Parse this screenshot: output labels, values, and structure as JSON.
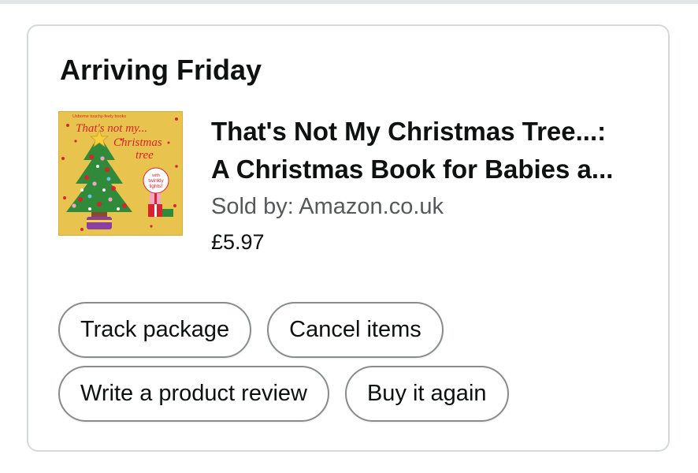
{
  "order": {
    "heading": "Arriving Friday",
    "item": {
      "title_line1": "That's Not My Christmas Tree...:",
      "title_line2": "A Christmas Book for Babies a...",
      "seller_label": "Sold by:",
      "seller_name": "Amazon.co.uk",
      "price": "£5.97",
      "cover": {
        "series_text": "Usborne touchy-feely books",
        "title_text_1": "That's not my...",
        "title_text_2": "Christmas",
        "title_text_3": "tree",
        "badge_text_1": "with",
        "badge_text_2": "twinkly",
        "badge_text_3": "lights!"
      }
    },
    "actions": {
      "track_label": "Track package",
      "cancel_label": "Cancel items",
      "review_label": "Write a product review",
      "buy_again_label": "Buy it again"
    }
  },
  "colors": {
    "text": "#0f1111",
    "secondary_text": "#565959",
    "border": "#d5d9d9",
    "button_border": "#888c8c",
    "cover_background": "#e8c44f",
    "cover_accent": "#d9232e",
    "tree_green": "#2f8a3a"
  }
}
